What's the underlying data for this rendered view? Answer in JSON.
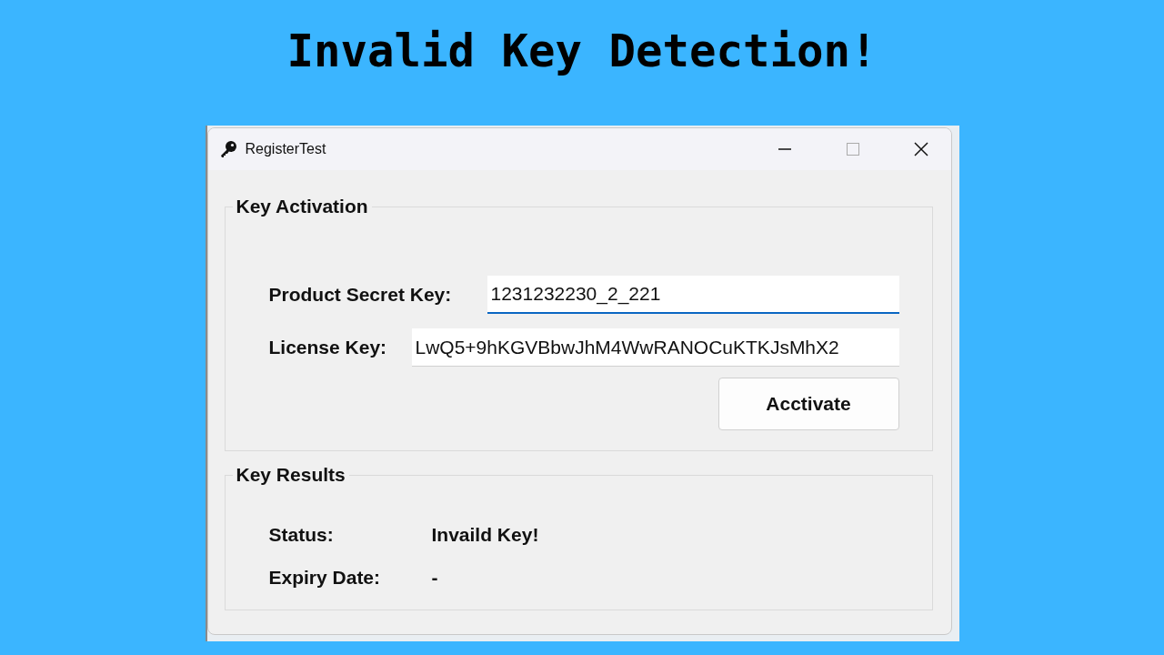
{
  "heading": "Invalid Key Detection!",
  "window": {
    "title": "RegisterTest"
  },
  "activation": {
    "title": "Key Activation",
    "fields": [
      {
        "label": "Product Secret Key:",
        "value": "1231232230_2_221",
        "focused": true
      },
      {
        "label": "License Key:",
        "value": "LwQ5+9hKGVBbwJhM4WwRANOCuKTKJsMhX2",
        "focused": false
      }
    ],
    "button": "Acctivate"
  },
  "results": {
    "title": "Key Results",
    "rows": [
      {
        "label": "Status:",
        "value": "Invaild Key!"
      },
      {
        "label": "Expiry Date:",
        "value": "-"
      }
    ]
  }
}
